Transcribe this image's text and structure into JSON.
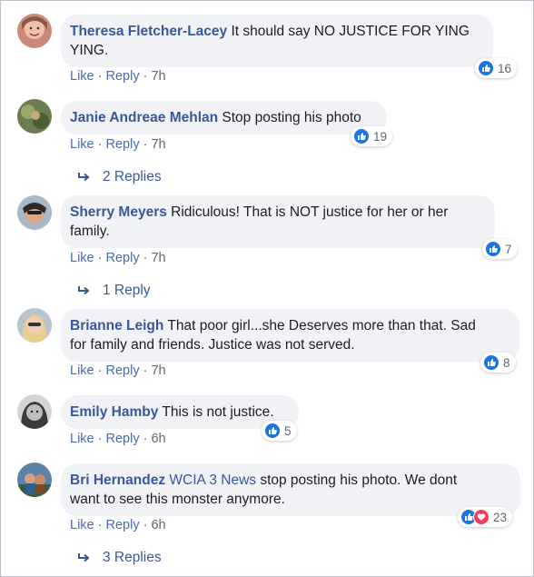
{
  "comments": [
    {
      "author": "Theresa Fletcher-Lacey",
      "text": "It should say NO JUSTICE FOR YING",
      "text2": "YING.",
      "like": "Like",
      "reply": "Reply",
      "time": "7h",
      "reactions": "16",
      "icon": "like-icon"
    },
    {
      "author": "Janie Andreae Mehlan",
      "text": "Stop posting his photo",
      "like": "Like",
      "reply": "Reply",
      "time": "7h",
      "reactions": "19",
      "replies": "2 Replies"
    },
    {
      "author": "Sherry Meyers",
      "text": "Ridiculous! That is NOT justice for her or her",
      "text2": "family.",
      "like": "Like",
      "reply": "Reply",
      "time": "7h",
      "reactions": "7",
      "replies": "1 Reply"
    },
    {
      "author": "Brianne Leigh",
      "text": "That poor girl...she Deserves more than that. Sad",
      "text2": "for family and friends. Justice was not served.",
      "like": "Like",
      "reply": "Reply",
      "time": "7h",
      "reactions": "8"
    },
    {
      "author": "Emily Hamby",
      "text": "This is not justice.",
      "like": "Like",
      "reply": "Reply",
      "time": "6h",
      "reactions": "5"
    },
    {
      "author": "Bri Hernandez",
      "mention": "WCIA 3 News",
      "text": "stop posting his photo. We dont",
      "text2": "want to see this monster anymore.",
      "like": "Like",
      "reply": "Reply",
      "time": "6h",
      "reactions": "23",
      "replies": "3 Replies"
    }
  ],
  "colors": {
    "author": "#385898",
    "bubble": "#f0f2f5",
    "like": "#1b74e4",
    "love": "#f33e58"
  }
}
